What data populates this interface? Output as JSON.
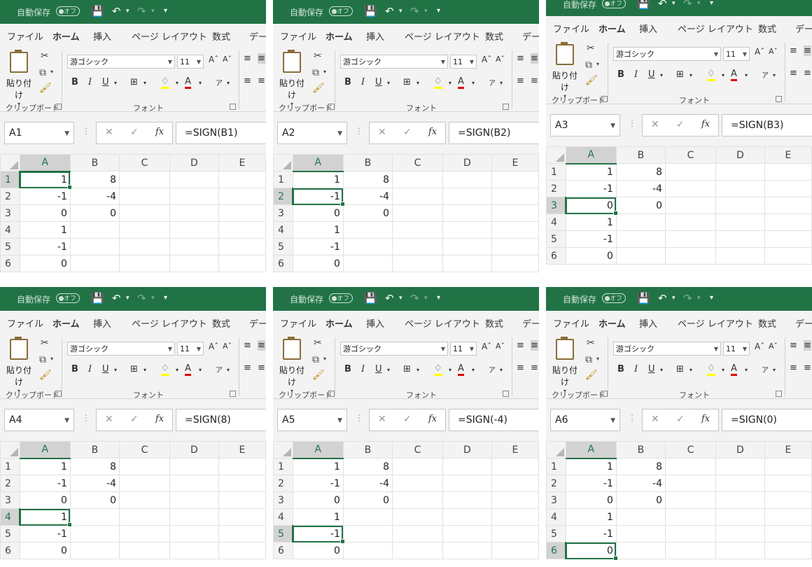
{
  "common": {
    "autosave_label": "自動保存",
    "autosave_state": "オフ",
    "menu": [
      "ファイル",
      "ホーム",
      "挿入",
      "ページ レイアウト",
      "数式",
      "デー"
    ],
    "paste_label": "貼り付け",
    "font_name": "游ゴシック",
    "font_size": "11",
    "clipboard_label": "クリップボード",
    "font_group_label": "フォント",
    "fx_label": "fx",
    "column_headers": [
      "A",
      "B",
      "C",
      "D",
      "E"
    ],
    "bold": "B",
    "italic": "I",
    "underline": "U",
    "font_color": "A",
    "cancel_symbol": "✕",
    "enter_symbol": "✓"
  },
  "panels": [
    {
      "cell_ref": "A1",
      "formula": "=SIGN(B1)",
      "active_row": 1
    },
    {
      "cell_ref": "A2",
      "formula": "=SIGN(B2)",
      "active_row": 2
    },
    {
      "cell_ref": "A3",
      "formula": "=SIGN(B3)",
      "active_row": 3
    },
    {
      "cell_ref": "A4",
      "formula": "=SIGN(8)",
      "active_row": 4
    },
    {
      "cell_ref": "A5",
      "formula": "=SIGN(-4)",
      "active_row": 5
    },
    {
      "cell_ref": "A6",
      "formula": "=SIGN(0)",
      "active_row": 6
    }
  ],
  "sheet_rows": [
    {
      "row": "1",
      "A": "1",
      "B": "8"
    },
    {
      "row": "2",
      "A": "-1",
      "B": "-4"
    },
    {
      "row": "3",
      "A": "0",
      "B": "0"
    },
    {
      "row": "4",
      "A": "1",
      "B": ""
    },
    {
      "row": "5",
      "A": "-1",
      "B": ""
    },
    {
      "row": "6",
      "A": "0",
      "B": ""
    }
  ]
}
